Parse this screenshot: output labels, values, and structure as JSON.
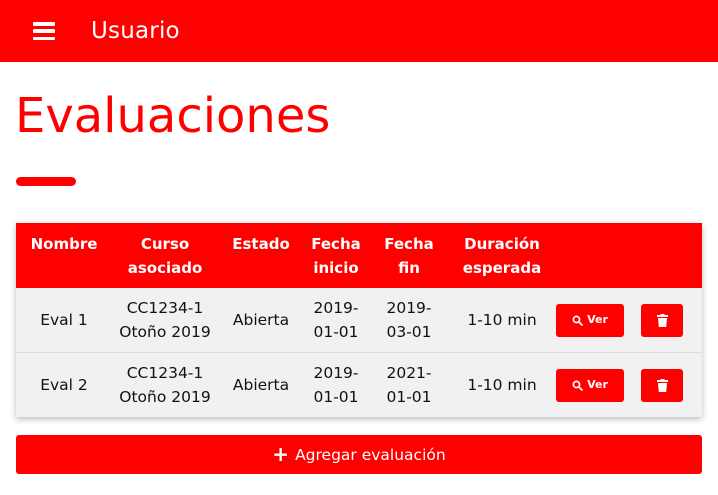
{
  "header": {
    "title": "Usuario",
    "menu_icon": "hamburger-menu-icon",
    "background": "#ff0000"
  },
  "page": {
    "title": "Evaluaciones",
    "accent": "#ff0000"
  },
  "table": {
    "columns": [
      "Nombre",
      "Curso asociado",
      "Estado",
      "Fecha inicio",
      "Fecha fin",
      "Duración esperada",
      ""
    ],
    "columns_wrapped": [
      [
        "Nombre"
      ],
      [
        "Curso",
        "asociado"
      ],
      [
        "Estado"
      ],
      [
        "Fecha",
        "inicio"
      ],
      [
        "Fecha",
        "fin"
      ],
      [
        "Duración",
        "esperada"
      ]
    ],
    "rows": [
      {
        "nombre": "Eval 1",
        "curso": [
          "CC1234-1",
          "Otoño 2019"
        ],
        "estado": "Abierta",
        "fecha_inicio": [
          "2019-",
          "01-01"
        ],
        "fecha_fin": [
          "2019-",
          "03-01"
        ],
        "duracion": "1-10 min",
        "view_label": "Ver"
      },
      {
        "nombre": "Eval 2",
        "curso": [
          "CC1234-1",
          "Otoño 2019"
        ],
        "estado": "Abierta",
        "fecha_inicio": [
          "2019-",
          "01-01"
        ],
        "fecha_fin": [
          "2021-",
          "01-01"
        ],
        "duracion": "1-10 min",
        "view_label": "Ver"
      }
    ],
    "row_background": "#f1f1f1",
    "view_icon": "magnifier-icon",
    "delete_icon": "trash-icon"
  },
  "add_button": {
    "icon": "plus-icon",
    "label": "Agregar evaluación"
  }
}
